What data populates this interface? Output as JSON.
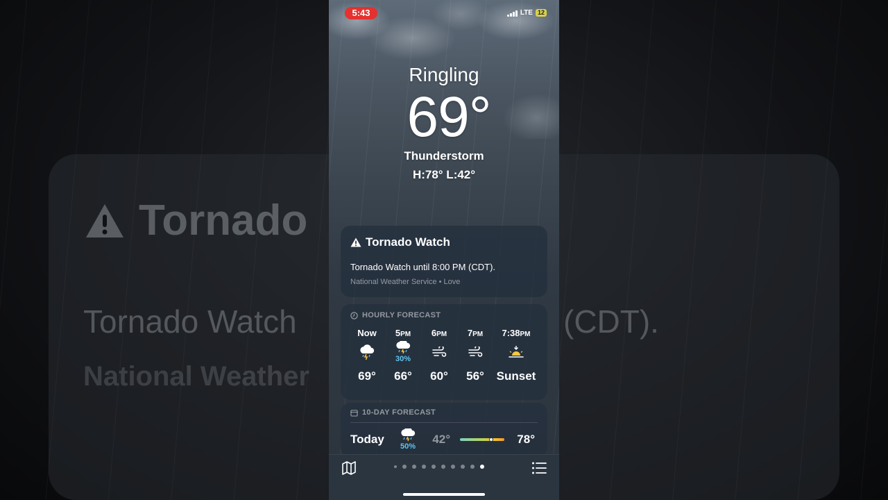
{
  "status_bar": {
    "time": "5:43",
    "network": "LTE",
    "battery": "12"
  },
  "location": {
    "city": "Ringling",
    "temperature": "69°",
    "condition": "Thunderstorm",
    "high_low": "H:78°  L:42°"
  },
  "alert": {
    "title": "Tornado Watch",
    "text": "Tornado Watch until 8:00 PM (CDT).",
    "source": "National Weather Service • Love"
  },
  "hourly": {
    "header": "HOURLY FORECAST",
    "items": [
      {
        "time": "Now",
        "suffix": "",
        "icon": "thunderstorm-icon",
        "precip": "",
        "temp": "69°"
      },
      {
        "time": "5",
        "suffix": "PM",
        "icon": "thunder-rain-icon",
        "precip": "30%",
        "temp": "66°"
      },
      {
        "time": "6",
        "suffix": "PM",
        "icon": "wind-icon",
        "precip": "",
        "temp": "60°"
      },
      {
        "time": "7",
        "suffix": "PM",
        "icon": "wind-icon",
        "precip": "",
        "temp": "56°"
      },
      {
        "time": "7:38",
        "suffix": "PM",
        "icon": "sunset-icon",
        "precip": "",
        "temp": "Sunset"
      }
    ]
  },
  "ten_day": {
    "header": "10-DAY FORECAST",
    "days": [
      {
        "day": "Today",
        "icon": "thunder-rain-icon",
        "precip": "50%",
        "low": "42°",
        "high": "78°",
        "current_position": 0.7
      }
    ]
  },
  "page_dots": {
    "count": 10,
    "active_index": 9
  },
  "background_overlay": {
    "title": "Tornado",
    "line": "Tornado Watch",
    "line_tail": "(CDT).",
    "sub": "National Weather"
  },
  "colors": {
    "alert_badge": "#e5312f",
    "precip": "#5fc4f0",
    "sun": "#f5c842"
  }
}
